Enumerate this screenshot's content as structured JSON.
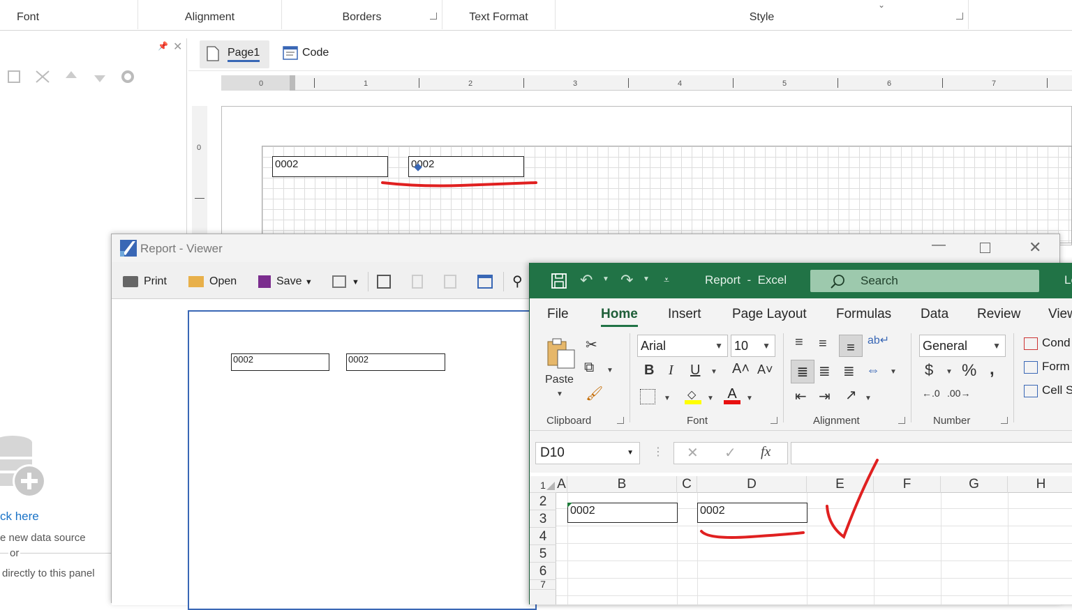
{
  "ribbon": {
    "groups": [
      "Font",
      "Alignment",
      "Borders",
      "Text Format",
      "Style"
    ]
  },
  "page_tabs": {
    "page1": "Page1",
    "code": "Code"
  },
  "ruler": {
    "h_ticks": [
      "0",
      "1",
      "2",
      "3",
      "4",
      "5",
      "6",
      "7"
    ],
    "v_tick": "0"
  },
  "designer": {
    "box1": "0002",
    "box2": "0002"
  },
  "left_panel": {
    "link": "ck here",
    "line1": "e new data source",
    "line2": "or",
    "line3": "directly to this panel"
  },
  "viewer": {
    "title": "Report - Viewer",
    "print": "Print",
    "open": "Open",
    "save": "Save",
    "box1": "0002",
    "box2": "0002"
  },
  "excel": {
    "title": "Report  -  Excel",
    "search": "Search",
    "title_extra": "Le",
    "tabs": [
      "File",
      "Home",
      "Insert",
      "Page Layout",
      "Formulas",
      "Data",
      "Review",
      "View"
    ],
    "font_name": "Arial",
    "font_size": "10",
    "number_format": "General",
    "paste": "Paste",
    "groups": {
      "clipboard": "Clipboard",
      "font": "Font",
      "alignment": "Alignment",
      "number": "Number"
    },
    "styles": [
      "Cond",
      "Form",
      "Cell S"
    ],
    "name_box": "D10",
    "columns": [
      "A",
      "B",
      "C",
      "D",
      "E",
      "F",
      "G",
      "H"
    ],
    "rows": [
      "1",
      "2",
      "3",
      "4",
      "5",
      "6",
      "7"
    ],
    "cell_b2": "0002",
    "cell_d2": "0002"
  },
  "colors": {
    "excel_green": "#217346",
    "annotation_red": "#e02020",
    "viewer_border": "#3967b5"
  }
}
